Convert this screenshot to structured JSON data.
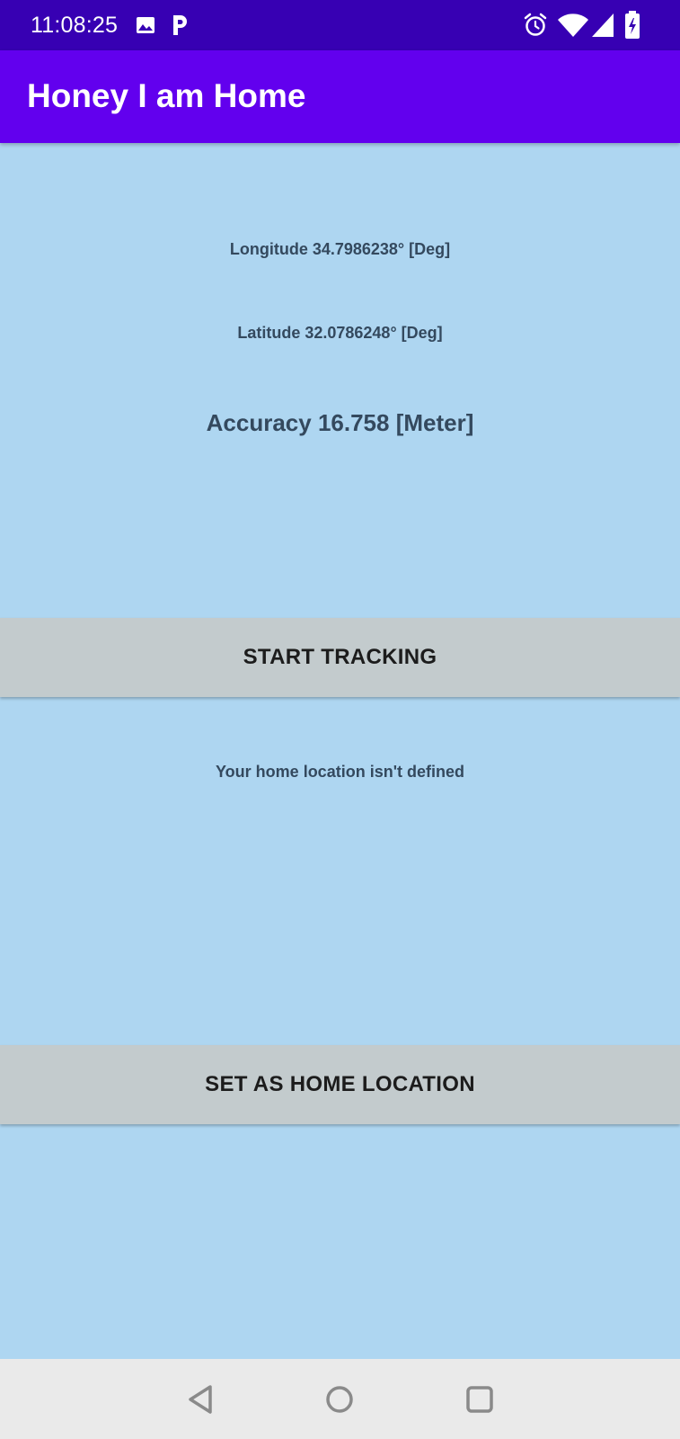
{
  "status_bar": {
    "time": "11:08:25",
    "icons": [
      "image-icon",
      "parking-icon",
      "alarm-icon",
      "wifi-icon",
      "signal-icon",
      "battery-charging-icon"
    ]
  },
  "app_bar": {
    "title": "Honey I am Home",
    "color": "#6200EE"
  },
  "location": {
    "longitude_text": "Longitude 34.7986238°  [Deg]",
    "latitude_text": "Latitude 32.0786248° [Deg]",
    "accuracy_text": "Accuracy 16.758 [Meter]"
  },
  "tracking": {
    "button_label": "START TRACKING"
  },
  "home": {
    "status_text": "Your home location isn't defined",
    "button_label": "SET AS HOME LOCATION"
  },
  "navigation": {
    "icons": [
      "back-icon",
      "home-icon",
      "recents-icon"
    ]
  },
  "colors": {
    "status_bar": "#3700B3",
    "app_bar": "#6200EE",
    "background": "#AED6F1",
    "button": "#C3CBCD",
    "text": "#34495E"
  }
}
